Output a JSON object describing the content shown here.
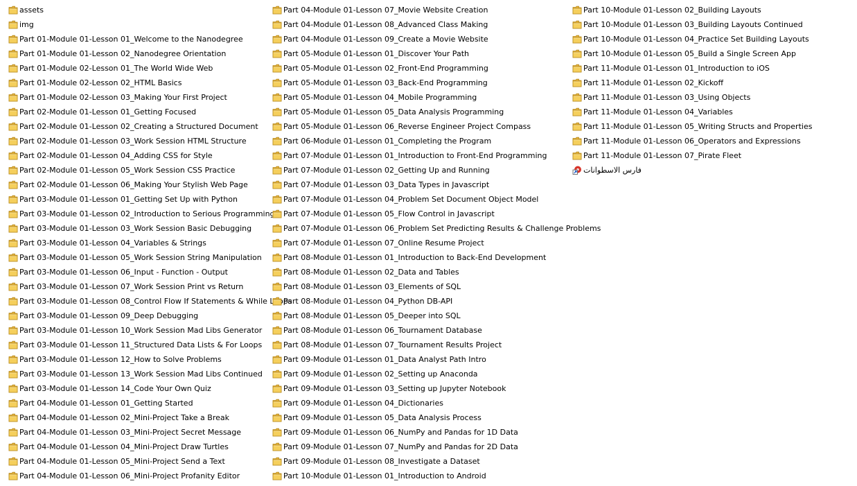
{
  "columns": [
    {
      "items": [
        {
          "type": "folder",
          "name": "assets"
        },
        {
          "type": "folder",
          "name": "img"
        },
        {
          "type": "folder",
          "name": "Part 01-Module 01-Lesson 01_Welcome to the Nanodegree"
        },
        {
          "type": "folder",
          "name": "Part 01-Module 01-Lesson 02_Nanodegree Orientation"
        },
        {
          "type": "folder",
          "name": "Part 01-Module 02-Lesson 01_The World Wide Web"
        },
        {
          "type": "folder",
          "name": "Part 01-Module 02-Lesson 02_HTML Basics"
        },
        {
          "type": "folder",
          "name": "Part 01-Module 02-Lesson 03_Making Your First Project"
        },
        {
          "type": "folder",
          "name": "Part 02-Module 01-Lesson 01_Getting Focused"
        },
        {
          "type": "folder",
          "name": "Part 02-Module 01-Lesson 02_Creating a Structured Document"
        },
        {
          "type": "folder",
          "name": "Part 02-Module 01-Lesson 03_Work Session HTML Structure"
        },
        {
          "type": "folder",
          "name": "Part 02-Module 01-Lesson 04_Adding CSS for Style"
        },
        {
          "type": "folder",
          "name": "Part 02-Module 01-Lesson 05_Work Session CSS Practice"
        },
        {
          "type": "folder",
          "name": "Part 02-Module 01-Lesson 06_Making Your Stylish Web Page"
        },
        {
          "type": "folder",
          "name": "Part 03-Module 01-Lesson 01_Getting Set Up with Python"
        },
        {
          "type": "folder",
          "name": "Part 03-Module 01-Lesson 02_Introduction to Serious Programming"
        },
        {
          "type": "folder",
          "name": "Part 03-Module 01-Lesson 03_Work Session Basic Debugging"
        },
        {
          "type": "folder",
          "name": "Part 03-Module 01-Lesson 04_Variables & Strings"
        },
        {
          "type": "folder",
          "name": "Part 03-Module 01-Lesson 05_Work Session String Manipulation"
        },
        {
          "type": "folder",
          "name": "Part 03-Module 01-Lesson 06_Input - Function - Output"
        },
        {
          "type": "folder",
          "name": "Part 03-Module 01-Lesson 07_Work Session Print vs Return"
        },
        {
          "type": "folder",
          "name": "Part 03-Module 01-Lesson 08_Control Flow If Statements & While Loops"
        },
        {
          "type": "folder",
          "name": "Part 03-Module 01-Lesson 09_Deep Debugging"
        },
        {
          "type": "folder",
          "name": "Part 03-Module 01-Lesson 10_Work Session Mad Libs Generator"
        },
        {
          "type": "folder",
          "name": "Part 03-Module 01-Lesson 11_Structured Data Lists & For Loops"
        },
        {
          "type": "folder",
          "name": "Part 03-Module 01-Lesson 12_How to Solve Problems"
        },
        {
          "type": "folder",
          "name": "Part 03-Module 01-Lesson 13_Work Session Mad Libs Continued"
        },
        {
          "type": "folder",
          "name": "Part 03-Module 01-Lesson 14_Code Your Own Quiz"
        },
        {
          "type": "folder",
          "name": "Part 04-Module 01-Lesson 01_Getting Started"
        },
        {
          "type": "folder",
          "name": "Part 04-Module 01-Lesson 02_Mini-Project Take a Break"
        },
        {
          "type": "folder",
          "name": "Part 04-Module 01-Lesson 03_Mini-Project Secret Message"
        },
        {
          "type": "folder",
          "name": "Part 04-Module 01-Lesson 04_Mini-Project Draw Turtles"
        },
        {
          "type": "folder",
          "name": "Part 04-Module 01-Lesson 05_Mini-Project Send a Text"
        },
        {
          "type": "folder",
          "name": "Part 04-Module 01-Lesson 06_Mini-Project Profanity Editor"
        }
      ]
    },
    {
      "items": [
        {
          "type": "folder",
          "name": "Part 04-Module 01-Lesson 07_Movie Website Creation"
        },
        {
          "type": "folder",
          "name": "Part 04-Module 01-Lesson 08_Advanced Class Making"
        },
        {
          "type": "folder",
          "name": "Part 04-Module 01-Lesson 09_Create a Movie Website"
        },
        {
          "type": "folder",
          "name": "Part 05-Module 01-Lesson 01_Discover Your Path"
        },
        {
          "type": "folder",
          "name": "Part 05-Module 01-Lesson 02_Front-End Programming"
        },
        {
          "type": "folder",
          "name": "Part 05-Module 01-Lesson 03_Back-End Programming"
        },
        {
          "type": "folder",
          "name": "Part 05-Module 01-Lesson 04_Mobile Programming"
        },
        {
          "type": "folder",
          "name": "Part 05-Module 01-Lesson 05_Data Analysis Programming"
        },
        {
          "type": "folder",
          "name": "Part 05-Module 01-Lesson 06_Reverse Engineer Project Compass"
        },
        {
          "type": "folder",
          "name": "Part 06-Module 01-Lesson 01_Completing the Program"
        },
        {
          "type": "folder",
          "name": "Part 07-Module 01-Lesson 01_Introduction to Front-End Programming"
        },
        {
          "type": "folder",
          "name": "Part 07-Module 01-Lesson 02_Getting Up and Running"
        },
        {
          "type": "folder",
          "name": "Part 07-Module 01-Lesson 03_Data Types in Javascript"
        },
        {
          "type": "folder",
          "name": "Part 07-Module 01-Lesson 04_Problem Set Document Object Model"
        },
        {
          "type": "folder",
          "name": "Part 07-Module 01-Lesson 05_Flow Control in Javascript"
        },
        {
          "type": "folder",
          "name": "Part 07-Module 01-Lesson 06_Problem Set Predicting Results & Challenge Problems"
        },
        {
          "type": "folder",
          "name": "Part 07-Module 01-Lesson 07_Online Resume Project"
        },
        {
          "type": "folder",
          "name": "Part 08-Module 01-Lesson 01_Introduction to Back-End Development"
        },
        {
          "type": "folder",
          "name": "Part 08-Module 01-Lesson 02_Data and Tables"
        },
        {
          "type": "folder",
          "name": "Part 08-Module 01-Lesson 03_Elements of SQL"
        },
        {
          "type": "folder",
          "name": "Part 08-Module 01-Lesson 04_Python DB-API"
        },
        {
          "type": "folder",
          "name": "Part 08-Module 01-Lesson 05_Deeper into SQL"
        },
        {
          "type": "folder",
          "name": "Part 08-Module 01-Lesson 06_Tournament Database"
        },
        {
          "type": "folder",
          "name": "Part 08-Module 01-Lesson 07_Tournament Results Project"
        },
        {
          "type": "folder",
          "name": "Part 09-Module 01-Lesson 01_Data Analyst Path Intro"
        },
        {
          "type": "folder",
          "name": "Part 09-Module 01-Lesson 02_Setting up Anaconda"
        },
        {
          "type": "folder",
          "name": "Part 09-Module 01-Lesson 03_Setting up Jupyter Notebook"
        },
        {
          "type": "folder",
          "name": "Part 09-Module 01-Lesson 04_Dictionaries"
        },
        {
          "type": "folder",
          "name": "Part 09-Module 01-Lesson 05_Data Analysis Process"
        },
        {
          "type": "folder",
          "name": "Part 09-Module 01-Lesson 06_NumPy and Pandas for 1D Data"
        },
        {
          "type": "folder",
          "name": "Part 09-Module 01-Lesson 07_NumPy and Pandas for 2D Data"
        },
        {
          "type": "folder",
          "name": "Part 09-Module 01-Lesson 08_Investigate a Dataset"
        },
        {
          "type": "folder",
          "name": "Part 10-Module 01-Lesson 01_Introduction to Android"
        }
      ]
    },
    {
      "items": [
        {
          "type": "folder",
          "name": "Part 10-Module 01-Lesson 02_Building Layouts"
        },
        {
          "type": "folder",
          "name": "Part 10-Module 01-Lesson 03_Building Layouts Continued"
        },
        {
          "type": "folder",
          "name": "Part 10-Module 01-Lesson 04_Practice Set Building Layouts"
        },
        {
          "type": "folder",
          "name": "Part 10-Module 01-Lesson 05_Build a Single Screen App"
        },
        {
          "type": "folder",
          "name": "Part 11-Module 01-Lesson 01_Introduction to iOS"
        },
        {
          "type": "folder",
          "name": "Part 11-Module 01-Lesson 02_Kickoff"
        },
        {
          "type": "folder",
          "name": "Part 11-Module 01-Lesson 03_Using Objects"
        },
        {
          "type": "folder",
          "name": "Part 11-Module 01-Lesson 04_Variables"
        },
        {
          "type": "folder",
          "name": "Part 11-Module 01-Lesson 05_Writing Structs and Properties"
        },
        {
          "type": "folder",
          "name": "Part 11-Module 01-Lesson 06_Operators and Expressions"
        },
        {
          "type": "folder",
          "name": "Part 11-Module 01-Lesson 07_Pirate Fleet"
        },
        {
          "type": "shortcut",
          "name": "فارس الاسطوانات",
          "rtl": true
        }
      ]
    }
  ],
  "colors": {
    "folder_body": "#f5cf5c",
    "folder_tab": "#e3b23c",
    "folder_edge": "#b88a1f",
    "shortcut_red": "#d9352b",
    "shortcut_arrow": "#1e5fc9"
  }
}
